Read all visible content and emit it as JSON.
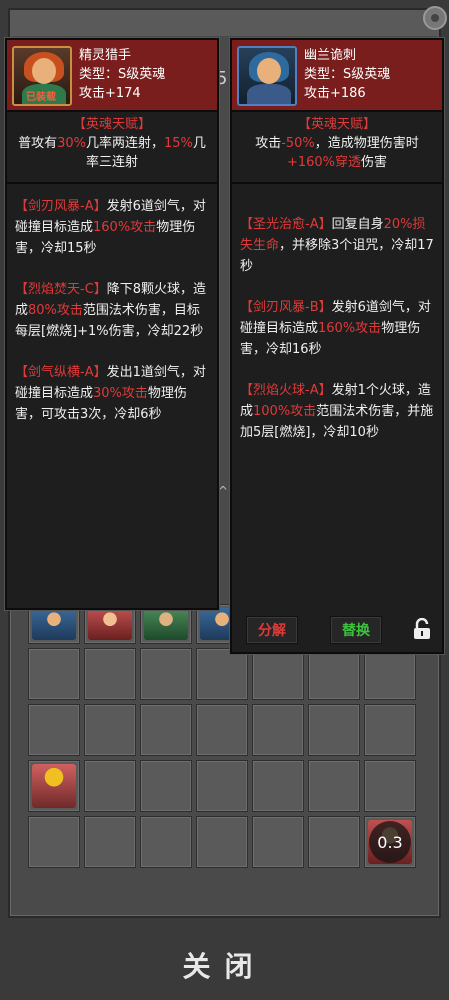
{
  "left_card": {
    "name": "精灵猎手",
    "type": "类型：S级英魂",
    "attack": "攻击+174",
    "equipped_badge": "已装载",
    "talent_title": "【英魂天赋】",
    "talent_parts": [
      "普攻有",
      "30%",
      "几率两连射，",
      "15%",
      "几率三连射"
    ],
    "skills": [
      {
        "name": "【剑刃风暴-A】",
        "parts": [
          "发射6道剑气，对碰撞目标造成",
          "160%攻击",
          "物理伤害，冷却15秒"
        ]
      },
      {
        "name": "【烈焰焚天-C】",
        "parts": [
          "降下8颗火球，造成",
          "80%攻击",
          "范围法术伤害，目标每层[燃烧]+1%伤害，冷却22秒"
        ]
      },
      {
        "name": "【剑气纵横-A】",
        "parts": [
          "发出1道剑气，对碰撞目标造成",
          "30%攻击",
          "物理伤害，可攻击3次，冷却6秒"
        ]
      }
    ]
  },
  "right_card": {
    "name": "幽兰诡刺",
    "type": "类型：S级英魂",
    "attack": "攻击+186",
    "talent_title": "【英魂天赋】",
    "talent_parts": [
      "攻击",
      "-50%",
      "，造成物理伤害时",
      "+160%穿透",
      "伤害"
    ],
    "skills": [
      {
        "name": "【圣光治愈-A】",
        "parts": [
          "回复自身",
          "20%损失生命",
          "，并移除3个诅咒，冷却17秒"
        ]
      },
      {
        "name": "【剑刃风暴-B】",
        "parts": [
          "发射6道剑气，对碰撞目标造成",
          "160%攻击",
          "物理伤害，冷却16秒"
        ]
      },
      {
        "name": "【烈焰火球-A】",
        "parts": [
          "发射1个火球，造成",
          "100%攻击",
          "范围法术伤害，并施加5层[燃烧]，冷却10秒"
        ]
      }
    ],
    "buttons": {
      "decompose": "分解",
      "replace": "替换"
    }
  },
  "background": {
    "digit": "5",
    "arrow": "^"
  },
  "grid": {
    "cooldown_value": "0.3"
  },
  "footer": {
    "close_label": "关闭"
  },
  "colors": {
    "accent_red": "#e03a3a",
    "accent_green": "#3ec23e",
    "header_red": "#7a1d1d"
  }
}
